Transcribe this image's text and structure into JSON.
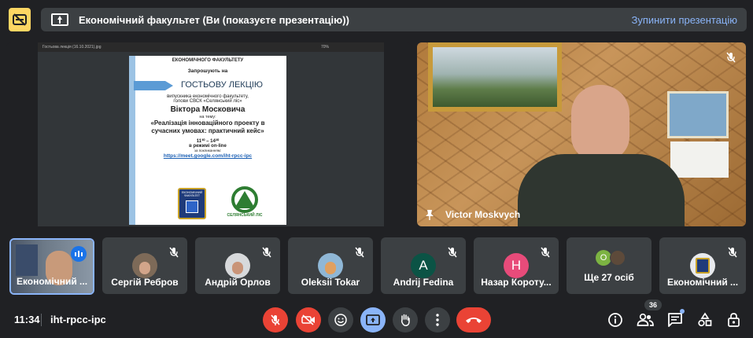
{
  "banner": {
    "title": "Економічний факультет (Ви (показуєте презентацію))",
    "stop_label": "Зупинити презентацію"
  },
  "presentation": {
    "viewer_filename": "Гостьова лекція (16.10.2021).jpg",
    "viewer_zoom": "70%",
    "slide": {
      "line1": "ЕКОНОМІЧНОГО ФАКУЛЬТЕТУ",
      "line2": "Запрошують на",
      "heading": "ГОСТЬОВУ ЛЕКЦІЮ",
      "line3": "випускника економічного факультету,",
      "line4": "голови СВСК «Селянський ліс»",
      "speaker": "Віктора Московича",
      "line5": "на тему:",
      "topic": "«Реалізація інноваційного проекту в сучасних умовах: практичний кейс»",
      "time": "11³⁰ – 14²⁰",
      "mode": "в режимі on-line",
      "link_label": "за покликанням:",
      "link": "https://meet.google.com/iht-rpcc-ipc",
      "logo1_text": "ЕКОНОМІЧНИЙ ФАКУЛЬТЕТ",
      "logo2_text": "СЕЛЯНСЬКИЙ ЛІС"
    }
  },
  "main_participant": {
    "name": "Victor Moskvych"
  },
  "participants": [
    {
      "name": "Економічний ...",
      "type": "video"
    },
    {
      "name": "Сергій Ребров",
      "type": "photo"
    },
    {
      "name": "Андрій Орлов",
      "type": "photo"
    },
    {
      "name": "Oleksii Tokar",
      "type": "photo"
    },
    {
      "name": "Andrij Fedina",
      "type": "letter",
      "letter": "A",
      "color": "#0b5345"
    },
    {
      "name": "Назар Короту...",
      "type": "letter",
      "letter": "Н",
      "color": "#e84b7a"
    },
    {
      "name": "Ще 27 осіб",
      "type": "more",
      "letter": "O",
      "color": "#7cb342"
    },
    {
      "name": "Економічний ...",
      "type": "photo"
    }
  ],
  "bottom_bar": {
    "time": "11:34",
    "meeting_code": "iht-rpcc-ipc",
    "participant_count": "36"
  },
  "colors": {
    "accent_blue": "#8ab4f8",
    "danger_red": "#ea4335",
    "warning_yellow": "#fdd663"
  }
}
